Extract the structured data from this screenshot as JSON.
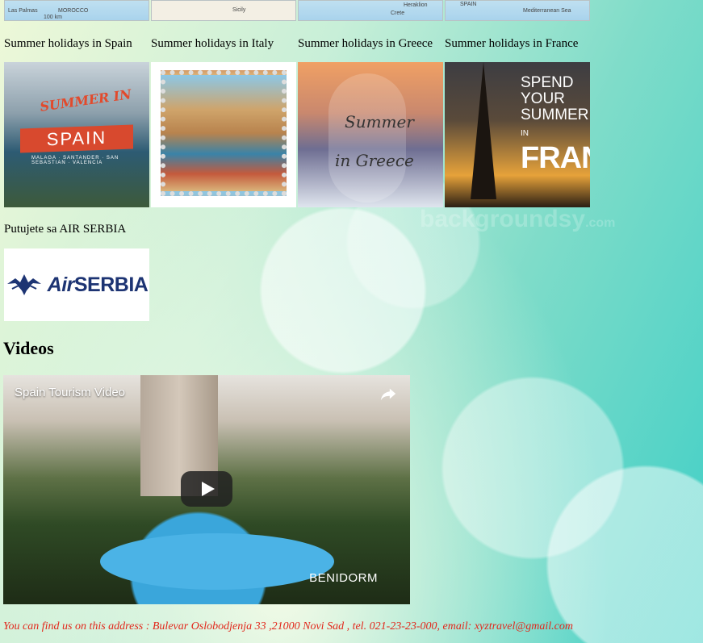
{
  "maps": [
    {
      "labels": [
        "Las Palmas",
        "MOROCCO",
        "100 km"
      ]
    },
    {
      "labels": [
        "Sicily"
      ]
    },
    {
      "labels": [
        "Heraklion",
        "Crete"
      ]
    },
    {
      "labels": [
        "SPAIN",
        "Mediterranean Sea"
      ]
    }
  ],
  "destinations": [
    {
      "caption": "Summer holidays in Spain",
      "image_text": [
        "SUMMER IN",
        "SPAIN",
        "MALAGA · SANTANDER · SAN SEBASTIAN · VALENCIA"
      ]
    },
    {
      "caption": "Summer holidays in Italy"
    },
    {
      "caption": "Summer holidays in Greece",
      "image_text": [
        "Summer",
        "in Greece"
      ]
    },
    {
      "caption": "Summer holidays in France",
      "image_text": [
        "SPEND YOUR",
        "SUMMER",
        "IN",
        "FRANCE"
      ]
    }
  ],
  "airline": {
    "text": "Putujete sa AIR SERBIA",
    "logo_air": "Air",
    "logo_serbia": "SERBIA"
  },
  "videos": {
    "heading": "Videos",
    "title": "Spain Tourism Video",
    "caption": "BENIDORM"
  },
  "watermark": {
    "text": "backgroundsy",
    "suffix": ".com"
  },
  "footer": "You can find us on this address : Bulevar Oslobodjenja 33 ,21000 Novi Sad , tel. 021-23-23-000, email: xyztravel@gmail.com",
  "colors": {
    "footer": "#e2271b",
    "logo": "#1d3473",
    "background_accent": "#3fcfc6"
  }
}
